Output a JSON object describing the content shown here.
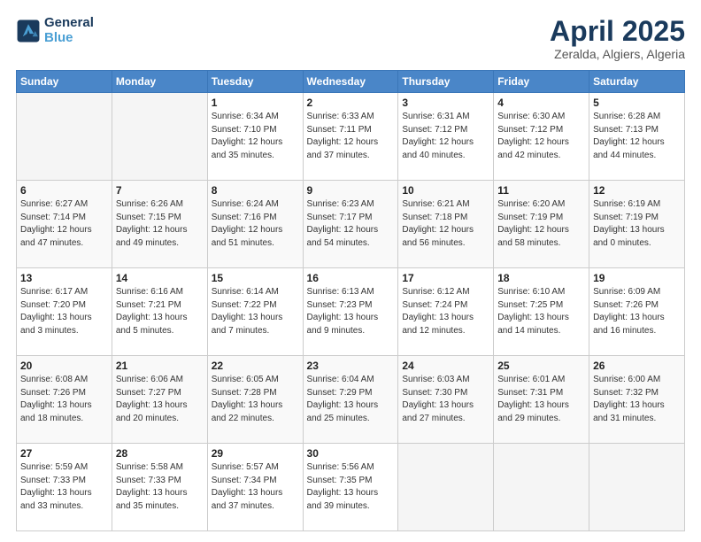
{
  "logo": {
    "line1": "General",
    "line2": "Blue"
  },
  "header": {
    "month": "April 2025",
    "location": "Zeralda, Algiers, Algeria"
  },
  "weekdays": [
    "Sunday",
    "Monday",
    "Tuesday",
    "Wednesday",
    "Thursday",
    "Friday",
    "Saturday"
  ],
  "weeks": [
    [
      {
        "day": "",
        "info": ""
      },
      {
        "day": "",
        "info": ""
      },
      {
        "day": "1",
        "info": "Sunrise: 6:34 AM\nSunset: 7:10 PM\nDaylight: 12 hours\nand 35 minutes."
      },
      {
        "day": "2",
        "info": "Sunrise: 6:33 AM\nSunset: 7:11 PM\nDaylight: 12 hours\nand 37 minutes."
      },
      {
        "day": "3",
        "info": "Sunrise: 6:31 AM\nSunset: 7:12 PM\nDaylight: 12 hours\nand 40 minutes."
      },
      {
        "day": "4",
        "info": "Sunrise: 6:30 AM\nSunset: 7:12 PM\nDaylight: 12 hours\nand 42 minutes."
      },
      {
        "day": "5",
        "info": "Sunrise: 6:28 AM\nSunset: 7:13 PM\nDaylight: 12 hours\nand 44 minutes."
      }
    ],
    [
      {
        "day": "6",
        "info": "Sunrise: 6:27 AM\nSunset: 7:14 PM\nDaylight: 12 hours\nand 47 minutes."
      },
      {
        "day": "7",
        "info": "Sunrise: 6:26 AM\nSunset: 7:15 PM\nDaylight: 12 hours\nand 49 minutes."
      },
      {
        "day": "8",
        "info": "Sunrise: 6:24 AM\nSunset: 7:16 PM\nDaylight: 12 hours\nand 51 minutes."
      },
      {
        "day": "9",
        "info": "Sunrise: 6:23 AM\nSunset: 7:17 PM\nDaylight: 12 hours\nand 54 minutes."
      },
      {
        "day": "10",
        "info": "Sunrise: 6:21 AM\nSunset: 7:18 PM\nDaylight: 12 hours\nand 56 minutes."
      },
      {
        "day": "11",
        "info": "Sunrise: 6:20 AM\nSunset: 7:19 PM\nDaylight: 12 hours\nand 58 minutes."
      },
      {
        "day": "12",
        "info": "Sunrise: 6:19 AM\nSunset: 7:19 PM\nDaylight: 13 hours\nand 0 minutes."
      }
    ],
    [
      {
        "day": "13",
        "info": "Sunrise: 6:17 AM\nSunset: 7:20 PM\nDaylight: 13 hours\nand 3 minutes."
      },
      {
        "day": "14",
        "info": "Sunrise: 6:16 AM\nSunset: 7:21 PM\nDaylight: 13 hours\nand 5 minutes."
      },
      {
        "day": "15",
        "info": "Sunrise: 6:14 AM\nSunset: 7:22 PM\nDaylight: 13 hours\nand 7 minutes."
      },
      {
        "day": "16",
        "info": "Sunrise: 6:13 AM\nSunset: 7:23 PM\nDaylight: 13 hours\nand 9 minutes."
      },
      {
        "day": "17",
        "info": "Sunrise: 6:12 AM\nSunset: 7:24 PM\nDaylight: 13 hours\nand 12 minutes."
      },
      {
        "day": "18",
        "info": "Sunrise: 6:10 AM\nSunset: 7:25 PM\nDaylight: 13 hours\nand 14 minutes."
      },
      {
        "day": "19",
        "info": "Sunrise: 6:09 AM\nSunset: 7:26 PM\nDaylight: 13 hours\nand 16 minutes."
      }
    ],
    [
      {
        "day": "20",
        "info": "Sunrise: 6:08 AM\nSunset: 7:26 PM\nDaylight: 13 hours\nand 18 minutes."
      },
      {
        "day": "21",
        "info": "Sunrise: 6:06 AM\nSunset: 7:27 PM\nDaylight: 13 hours\nand 20 minutes."
      },
      {
        "day": "22",
        "info": "Sunrise: 6:05 AM\nSunset: 7:28 PM\nDaylight: 13 hours\nand 22 minutes."
      },
      {
        "day": "23",
        "info": "Sunrise: 6:04 AM\nSunset: 7:29 PM\nDaylight: 13 hours\nand 25 minutes."
      },
      {
        "day": "24",
        "info": "Sunrise: 6:03 AM\nSunset: 7:30 PM\nDaylight: 13 hours\nand 27 minutes."
      },
      {
        "day": "25",
        "info": "Sunrise: 6:01 AM\nSunset: 7:31 PM\nDaylight: 13 hours\nand 29 minutes."
      },
      {
        "day": "26",
        "info": "Sunrise: 6:00 AM\nSunset: 7:32 PM\nDaylight: 13 hours\nand 31 minutes."
      }
    ],
    [
      {
        "day": "27",
        "info": "Sunrise: 5:59 AM\nSunset: 7:33 PM\nDaylight: 13 hours\nand 33 minutes."
      },
      {
        "day": "28",
        "info": "Sunrise: 5:58 AM\nSunset: 7:33 PM\nDaylight: 13 hours\nand 35 minutes."
      },
      {
        "day": "29",
        "info": "Sunrise: 5:57 AM\nSunset: 7:34 PM\nDaylight: 13 hours\nand 37 minutes."
      },
      {
        "day": "30",
        "info": "Sunrise: 5:56 AM\nSunset: 7:35 PM\nDaylight: 13 hours\nand 39 minutes."
      },
      {
        "day": "",
        "info": ""
      },
      {
        "day": "",
        "info": ""
      },
      {
        "day": "",
        "info": ""
      }
    ]
  ]
}
